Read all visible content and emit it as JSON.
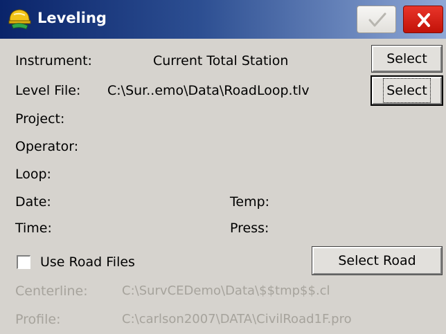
{
  "window": {
    "title": "Leveling",
    "ok_icon": "checkmark-icon",
    "close_icon": "close-icon",
    "app_icon": "helmet-logo-icon"
  },
  "instrument": {
    "label": "Instrument:",
    "value": "Current Total Station",
    "button": "Select"
  },
  "level_file": {
    "label": "Level File:",
    "value": "C:\\Sur..emo\\Data\\RoadLoop.tlv",
    "button": "Select"
  },
  "fields": {
    "project": "Project:",
    "operator": "Operator:",
    "loop": "Loop:",
    "date": "Date:",
    "temp": "Temp:",
    "time": "Time:",
    "press": "Press:"
  },
  "road": {
    "checkbox_label": "Use Road Files",
    "checked": false,
    "select_button": "Select Road",
    "centerline_label": "Centerline:",
    "centerline_value": "C:\\SurvCEDemo\\Data\\$$tmp$$.cl",
    "profile_label": "Profile:",
    "profile_value": "C:\\carlson2007\\DATA\\CivilRoad1F.pro"
  },
  "colors": {
    "title_gradient_start": "#0a246a",
    "title_gradient_end": "#8fa8d6",
    "close_button": "#d8241a",
    "disabled_text": "#a6a39c",
    "background": "#d6d3ce"
  }
}
